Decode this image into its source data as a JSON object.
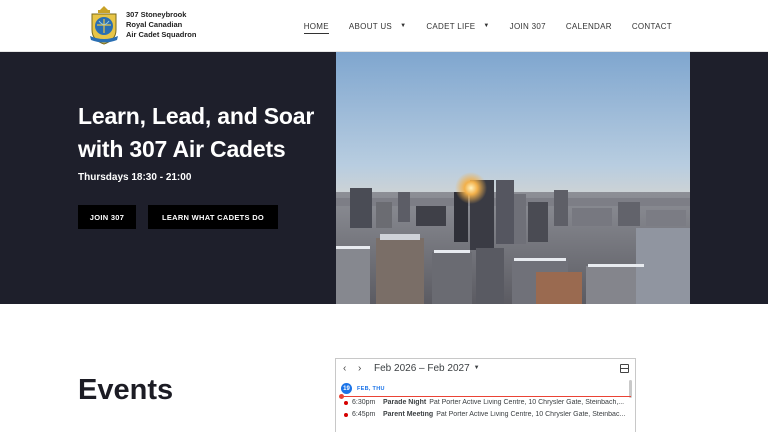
{
  "header": {
    "org_name_lines": [
      "307 Stoneybrook",
      "Royal Canadian",
      "Air Cadet Squadron"
    ],
    "logo_icon": "squadron-crest-icon",
    "nav": [
      {
        "label": "HOME",
        "active": true,
        "dropdown": false
      },
      {
        "label": "ABOUT US",
        "active": false,
        "dropdown": true
      },
      {
        "label": "CADET LIFE",
        "active": false,
        "dropdown": true
      },
      {
        "label": "JOIN 307",
        "active": false,
        "dropdown": false
      },
      {
        "label": "CALENDAR",
        "active": false,
        "dropdown": false
      },
      {
        "label": "CONTACT",
        "active": false,
        "dropdown": false
      }
    ]
  },
  "hero": {
    "title_line1": "Learn, Lead, and Soar",
    "title_line2": "with 307 Air Cadets",
    "subtitle": "Thursdays 18:30 - 21:00",
    "buttons": {
      "join": "JOIN 307",
      "learn": "LEARN WHAT CADETS DO"
    },
    "background_color": "#1e1f2b"
  },
  "events": {
    "title": "Events",
    "calendar": {
      "prev_icon": "chevron-left-icon",
      "next_icon": "chevron-right-icon",
      "range": "Feb 2026 – Feb 2027",
      "view_icon": "agenda-view-icon",
      "day_number": "19",
      "day_label": "FEB, THU",
      "items": [
        {
          "time": "6:30pm",
          "title": "Parade Night",
          "location": "Pat Porter Active Living Centre, 10 Chrysler Gate, Steinbach,..."
        },
        {
          "time": "6:45pm",
          "title": "Parent Meeting",
          "location": "Pat Porter Active Living Centre, 10 Chrysler Gate, Steinbac..."
        }
      ],
      "accent_color": "#1a73e8",
      "event_color": "#d50000"
    }
  }
}
